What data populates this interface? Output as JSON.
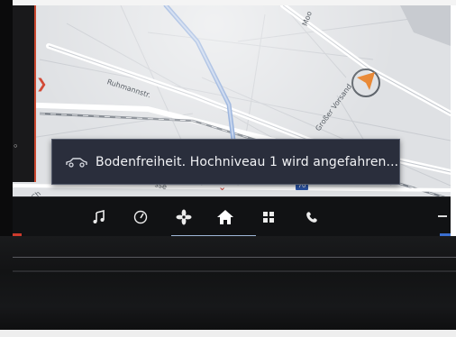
{
  "notification": {
    "icon": "car-icon",
    "message": "Bodenfreiheit. Hochniveau 1 wird angefahren..."
  },
  "map": {
    "road_labels": [
      "Ruhmannstr.",
      "Großer Vorsand",
      "Moo",
      "Ch",
      "sse"
    ],
    "speed_limit": "70",
    "position_marker": "navigation-arrow-icon"
  },
  "nav_bar": {
    "items": [
      {
        "name": "music-note-icon",
        "label": "Media"
      },
      {
        "name": "speedometer-icon",
        "label": "Driving"
      },
      {
        "name": "fan-icon",
        "label": "Climate"
      },
      {
        "name": "home-icon",
        "label": "Home",
        "active": true
      },
      {
        "name": "apps-grid-icon",
        "label": "Apps"
      },
      {
        "name": "phone-icon",
        "label": "Phone"
      }
    ]
  },
  "colors": {
    "toast_bg": "#2a2e3c",
    "accent_red": "#cc3a2c",
    "accent_blue": "#3b6fd0",
    "map_bg": "#dfe1e4"
  }
}
